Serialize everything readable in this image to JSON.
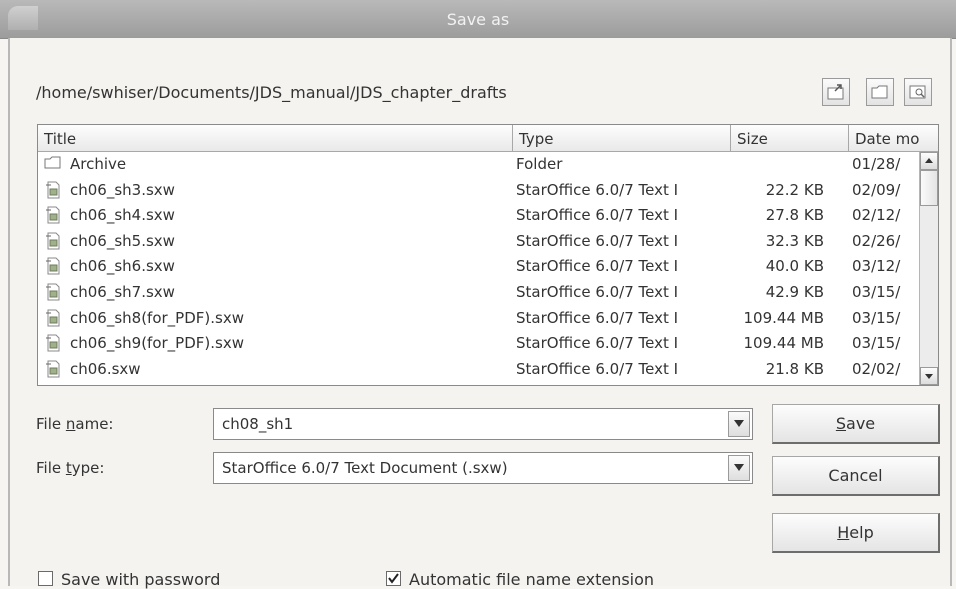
{
  "window": {
    "title": "Save as"
  },
  "path": "/home/swhiser/Documents/JDS_manual/JDS_chapter_drafts",
  "columns": {
    "title": "Title",
    "type": "Type",
    "size": "Size",
    "date": "Date mo"
  },
  "files": [
    {
      "name": "Archive",
      "kind": "folder",
      "type": "Folder",
      "size": "",
      "date": "01/28/"
    },
    {
      "name": "ch06_sh3.sxw",
      "kind": "doc",
      "type": "StarOffice 6.0/7 Text I",
      "size": "22.2 KB",
      "date": "02/09/"
    },
    {
      "name": "ch06_sh4.sxw",
      "kind": "doc",
      "type": "StarOffice 6.0/7 Text I",
      "size": "27.8 KB",
      "date": "02/12/"
    },
    {
      "name": "ch06_sh5.sxw",
      "kind": "doc",
      "type": "StarOffice 6.0/7 Text I",
      "size": "32.3 KB",
      "date": "02/26/"
    },
    {
      "name": "ch06_sh6.sxw",
      "kind": "doc",
      "type": "StarOffice 6.0/7 Text I",
      "size": "40.0 KB",
      "date": "03/12/"
    },
    {
      "name": "ch06_sh7.sxw",
      "kind": "doc",
      "type": "StarOffice 6.0/7 Text I",
      "size": "42.9 KB",
      "date": "03/15/"
    },
    {
      "name": "ch06_sh8(for_PDF).sxw",
      "kind": "doc",
      "type": "StarOffice 6.0/7 Text I",
      "size": "109.44 MB",
      "date": "03/15/"
    },
    {
      "name": "ch06_sh9(for_PDF).sxw",
      "kind": "doc",
      "type": "StarOffice 6.0/7 Text I",
      "size": "109.44 MB",
      "date": "03/15/"
    },
    {
      "name": "ch06.sxw",
      "kind": "doc",
      "type": "StarOffice 6.0/7 Text I",
      "size": "21.8 KB",
      "date": "02/02/"
    }
  ],
  "file_name": {
    "label_pre": "File ",
    "label_key": "n",
    "label_post": "ame:",
    "value": "ch08_sh1"
  },
  "file_type": {
    "label_pre": "File ",
    "label_key": "t",
    "label_post": "ype:",
    "value": "StarOffice 6.0/7 Text Document (.sxw)"
  },
  "buttons": {
    "save": {
      "key": "S",
      "rest": "ave"
    },
    "cancel": "Cancel",
    "help": {
      "key": "H",
      "rest": "elp"
    }
  },
  "options": {
    "save_password": {
      "label": "Save with password",
      "checked": false
    },
    "auto_extension": {
      "label": "Automatic file name extension",
      "checked": true
    }
  }
}
